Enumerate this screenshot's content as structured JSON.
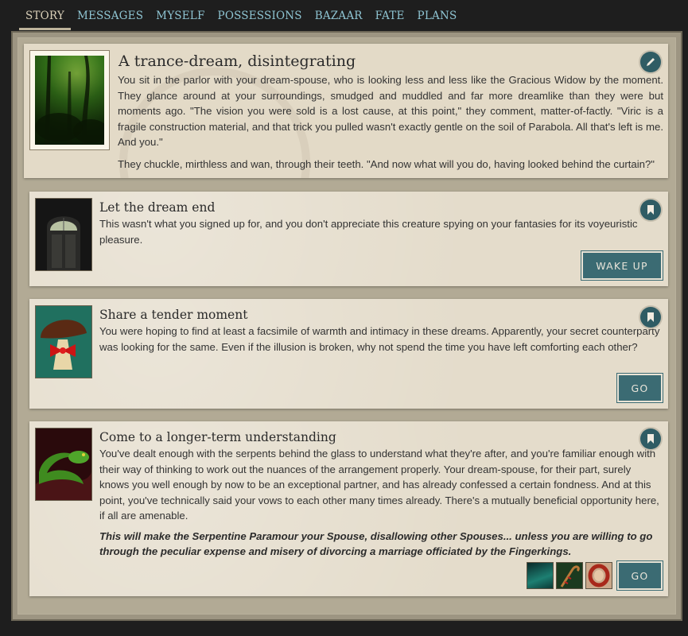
{
  "nav": {
    "tabs": [
      {
        "label": "STORY"
      },
      {
        "label": "MESSAGES"
      },
      {
        "label": "MYSELF"
      },
      {
        "label": "POSSESSIONS"
      },
      {
        "label": "BAZAAR"
      },
      {
        "label": "FATE"
      },
      {
        "label": "PLANS"
      }
    ],
    "active_tab": "STORY"
  },
  "storylet": {
    "title": "A trance-dream, disintegrating",
    "paragraphs": [
      "You sit in the parlor with your dream-spouse, who is looking less and less like the Gracious Widow by the moment. They glance around at your surroundings, smudged and muddled and far more dreamlike than they were but moments ago. \"The vision you were sold is a lost cause, at this point,\" they comment, matter-of-factly. \"Viric is a fragile construction material, and that trick you pulled wasn't exactly gentle on the soil of Parabola. All that's left is me. And you.\"",
      "They chuckle, mirthless and wan, through their teeth. \"And now what will you do, having looked behind the curtain?\""
    ],
    "edit_icon": "pencil-icon"
  },
  "branches": [
    {
      "title": "Let the dream end",
      "description": "This wasn't what you signed up for, and you don't appreciate this creature spying on your fantasies for its voyeuristic pleasure.",
      "button": "WAKE UP",
      "image": "arched-door"
    },
    {
      "title": "Share a tender moment",
      "description": "You were hoping to find at least a facsimile of warmth and intimacy in these dreams. Apparently, your secret counterparty was looking for the same. Even if the illusion is broken, why not spend the time you have left comforting each other?",
      "button": "GO",
      "image": "mushroom-bow"
    },
    {
      "title": "Come to a longer-term understanding",
      "description": "You've dealt enough with the serpents behind the glass to understand what they're after, and you're familiar enough with their way of thinking to work out the nuances of the arrangement properly. Your dream-spouse, for their part, surely knows you well enough by now to be an exceptional partner, and has already confessed a certain fondness. And at this point, you've technically said your vows to each other many times already. There's a mutually beneficial opportunity here, if all are amenable.",
      "note": "This will make the Serpentine Paramour your Spouse, disallowing other Spouses... unless you are willing to go through the peculiar expense and misery of divorcing a marriage officiated by the Fingerkings.",
      "button": "GO",
      "image": "green-serpent",
      "requirements": [
        "teal-glass",
        "serpent-cane",
        "red-ring"
      ]
    }
  ],
  "bookmark_icon": "bookmark-icon"
}
